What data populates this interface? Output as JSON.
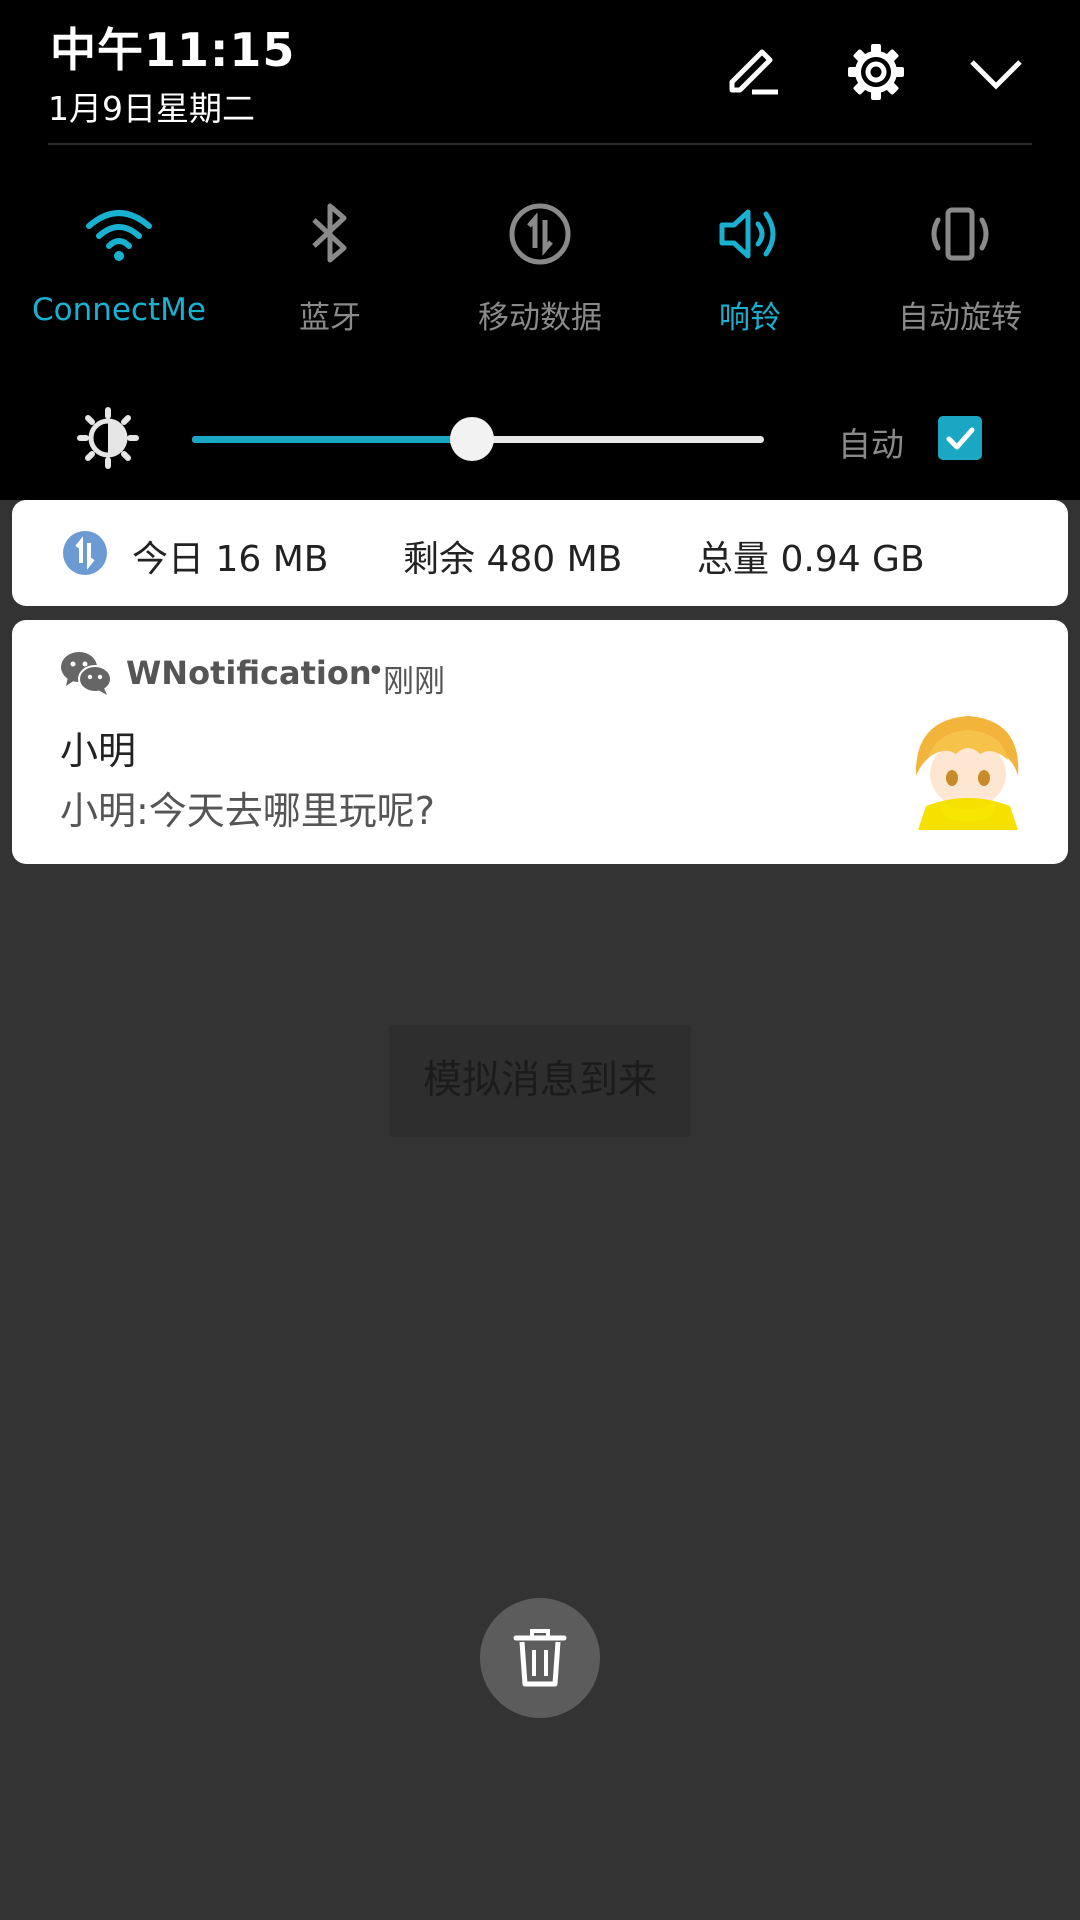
{
  "status": {
    "time": "中午11:15",
    "date": "1月9日星期二"
  },
  "header_actions": {
    "icons": [
      "edit-icon",
      "settings-gear-icon",
      "chevron-down-icon"
    ]
  },
  "quick_settings": {
    "tiles": [
      {
        "label": "ConnectMe",
        "icon": "wifi-icon",
        "active": true
      },
      {
        "label": "蓝牙",
        "icon": "bluetooth-icon",
        "active": false
      },
      {
        "label": "移动数据",
        "icon": "mobile-data-icon",
        "active": false
      },
      {
        "label": "响铃",
        "icon": "volume-icon",
        "active": true
      },
      {
        "label": "自动旋转",
        "icon": "auto-rotate-icon",
        "active": false
      }
    ],
    "accent_color": "#1ab0cf"
  },
  "brightness": {
    "icon": "brightness-icon",
    "level_percent": 49,
    "auto_label": "自动",
    "auto_checked": true
  },
  "data_usage": {
    "icon": "mobile-data-icon",
    "today": "今日 16 MB",
    "remaining": "剩余 480 MB",
    "total": "总量 0.94 GB"
  },
  "notification": {
    "app_icon": "wechat-icon",
    "app_name": "WNotification",
    "separator": "•",
    "time": "刚刚",
    "title": "小明",
    "body": "小明:今天去哪里玩呢?",
    "avatar": "avatar"
  },
  "simulate_button": {
    "label": "模拟消息到来"
  },
  "clear_button": {
    "icon": "trash-icon"
  }
}
